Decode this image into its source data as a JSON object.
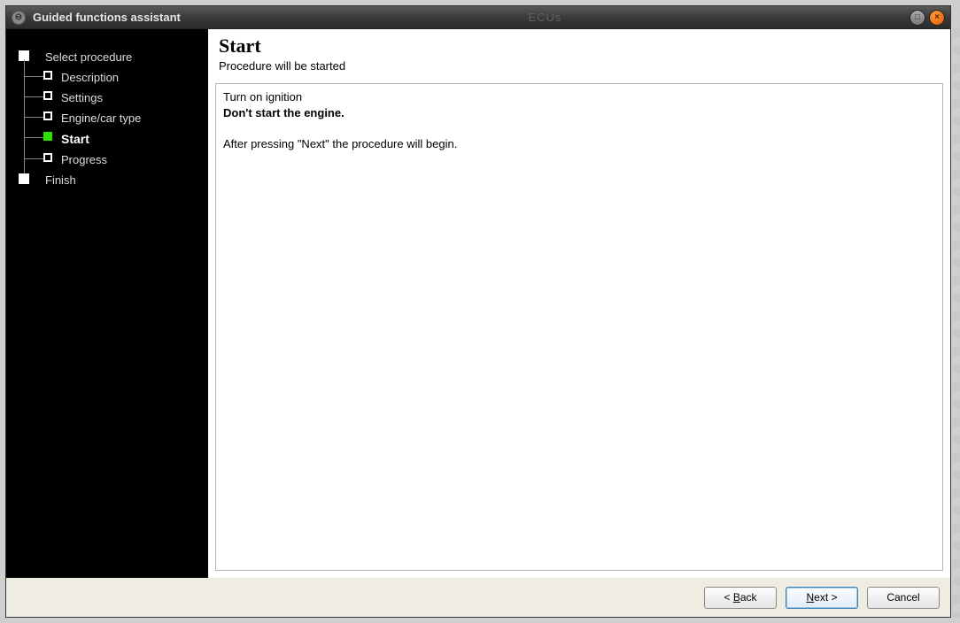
{
  "window": {
    "title": "Guided functions assistant",
    "bg_text": "ECUs"
  },
  "sidebar": {
    "items": [
      {
        "label": "Select procedure",
        "type": "root",
        "active": false
      },
      {
        "label": "Description",
        "type": "child",
        "active": false
      },
      {
        "label": "Settings",
        "type": "child",
        "active": false
      },
      {
        "label": "Engine/car type",
        "type": "child",
        "active": false
      },
      {
        "label": "Start",
        "type": "child",
        "active": true
      },
      {
        "label": "Progress",
        "type": "child",
        "active": false
      },
      {
        "label": "Finish",
        "type": "root",
        "active": false
      }
    ]
  },
  "main": {
    "title": "Start",
    "subtitle": "Procedure will be started",
    "instructions": {
      "line1": "Turn on ignition",
      "line2_bold": "Don't start the engine.",
      "line3": "",
      "line4": "After pressing \"Next\" the procedure will begin."
    }
  },
  "footer": {
    "back_prefix": "< ",
    "back_u": "B",
    "back_rest": "ack",
    "next_u": "N",
    "next_rest": "ext >",
    "cancel": "Cancel"
  }
}
